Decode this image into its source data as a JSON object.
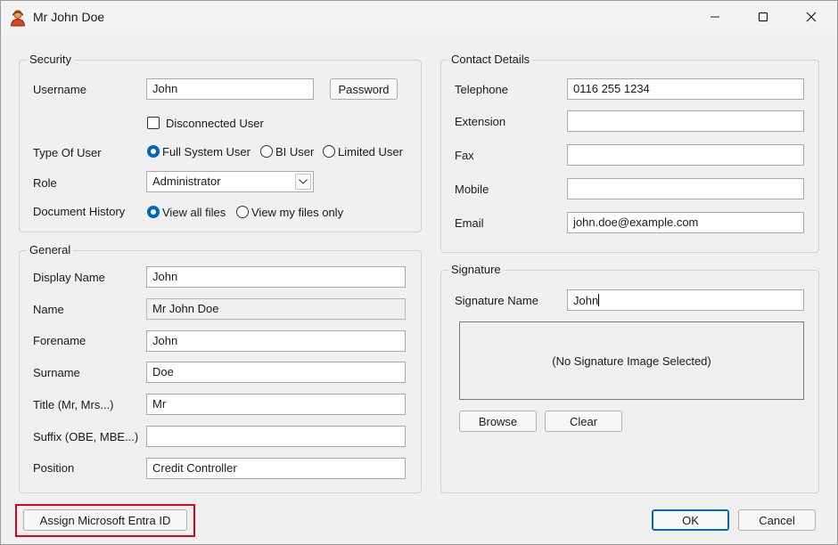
{
  "window": {
    "title": "Mr John Doe"
  },
  "security": {
    "title": "Security",
    "username_label": "Username",
    "username_value": "John",
    "password_button": "Password",
    "disconnected_label": "Disconnected User",
    "disconnected_checked": false,
    "type_label": "Type Of User",
    "type_options": [
      {
        "label": "Full System User",
        "selected": true
      },
      {
        "label": "BI User",
        "selected": false
      },
      {
        "label": "Limited User",
        "selected": false
      }
    ],
    "role_label": "Role",
    "role_value": "Administrator",
    "history_label": "Document History",
    "history_options": [
      {
        "label": "View all files",
        "selected": true
      },
      {
        "label": "View my files only",
        "selected": false
      }
    ]
  },
  "general": {
    "title": "General",
    "fields": [
      {
        "label": "Display Name",
        "value": "John"
      },
      {
        "label": "Name",
        "value": "Mr John Doe"
      },
      {
        "label": "Forename",
        "value": "John"
      },
      {
        "label": "Surname",
        "value": "Doe"
      },
      {
        "label": "Title (Mr, Mrs...)",
        "value": "Mr"
      },
      {
        "label": "Suffix (OBE, MBE...)",
        "value": ""
      },
      {
        "label": "Position",
        "value": "Credit Controller"
      }
    ]
  },
  "contact": {
    "title": "Contact Details",
    "fields": [
      {
        "label": "Telephone",
        "value": "0116 255 1234"
      },
      {
        "label": "Extension",
        "value": ""
      },
      {
        "label": "Fax",
        "value": ""
      },
      {
        "label": "Mobile",
        "value": ""
      },
      {
        "label": "Email",
        "value": "john.doe@example.com"
      }
    ]
  },
  "signature": {
    "title": "Signature",
    "name_label": "Signature Name",
    "name_value": "John",
    "image_placeholder": "(No Signature Image Selected)",
    "browse_button": "Browse",
    "clear_button": "Clear"
  },
  "footer": {
    "assign_button": "Assign Microsoft Entra ID",
    "ok_button": "OK",
    "cancel_button": "Cancel"
  },
  "colors": {
    "accent": "#0067c0",
    "highlight": "#e0001b"
  }
}
